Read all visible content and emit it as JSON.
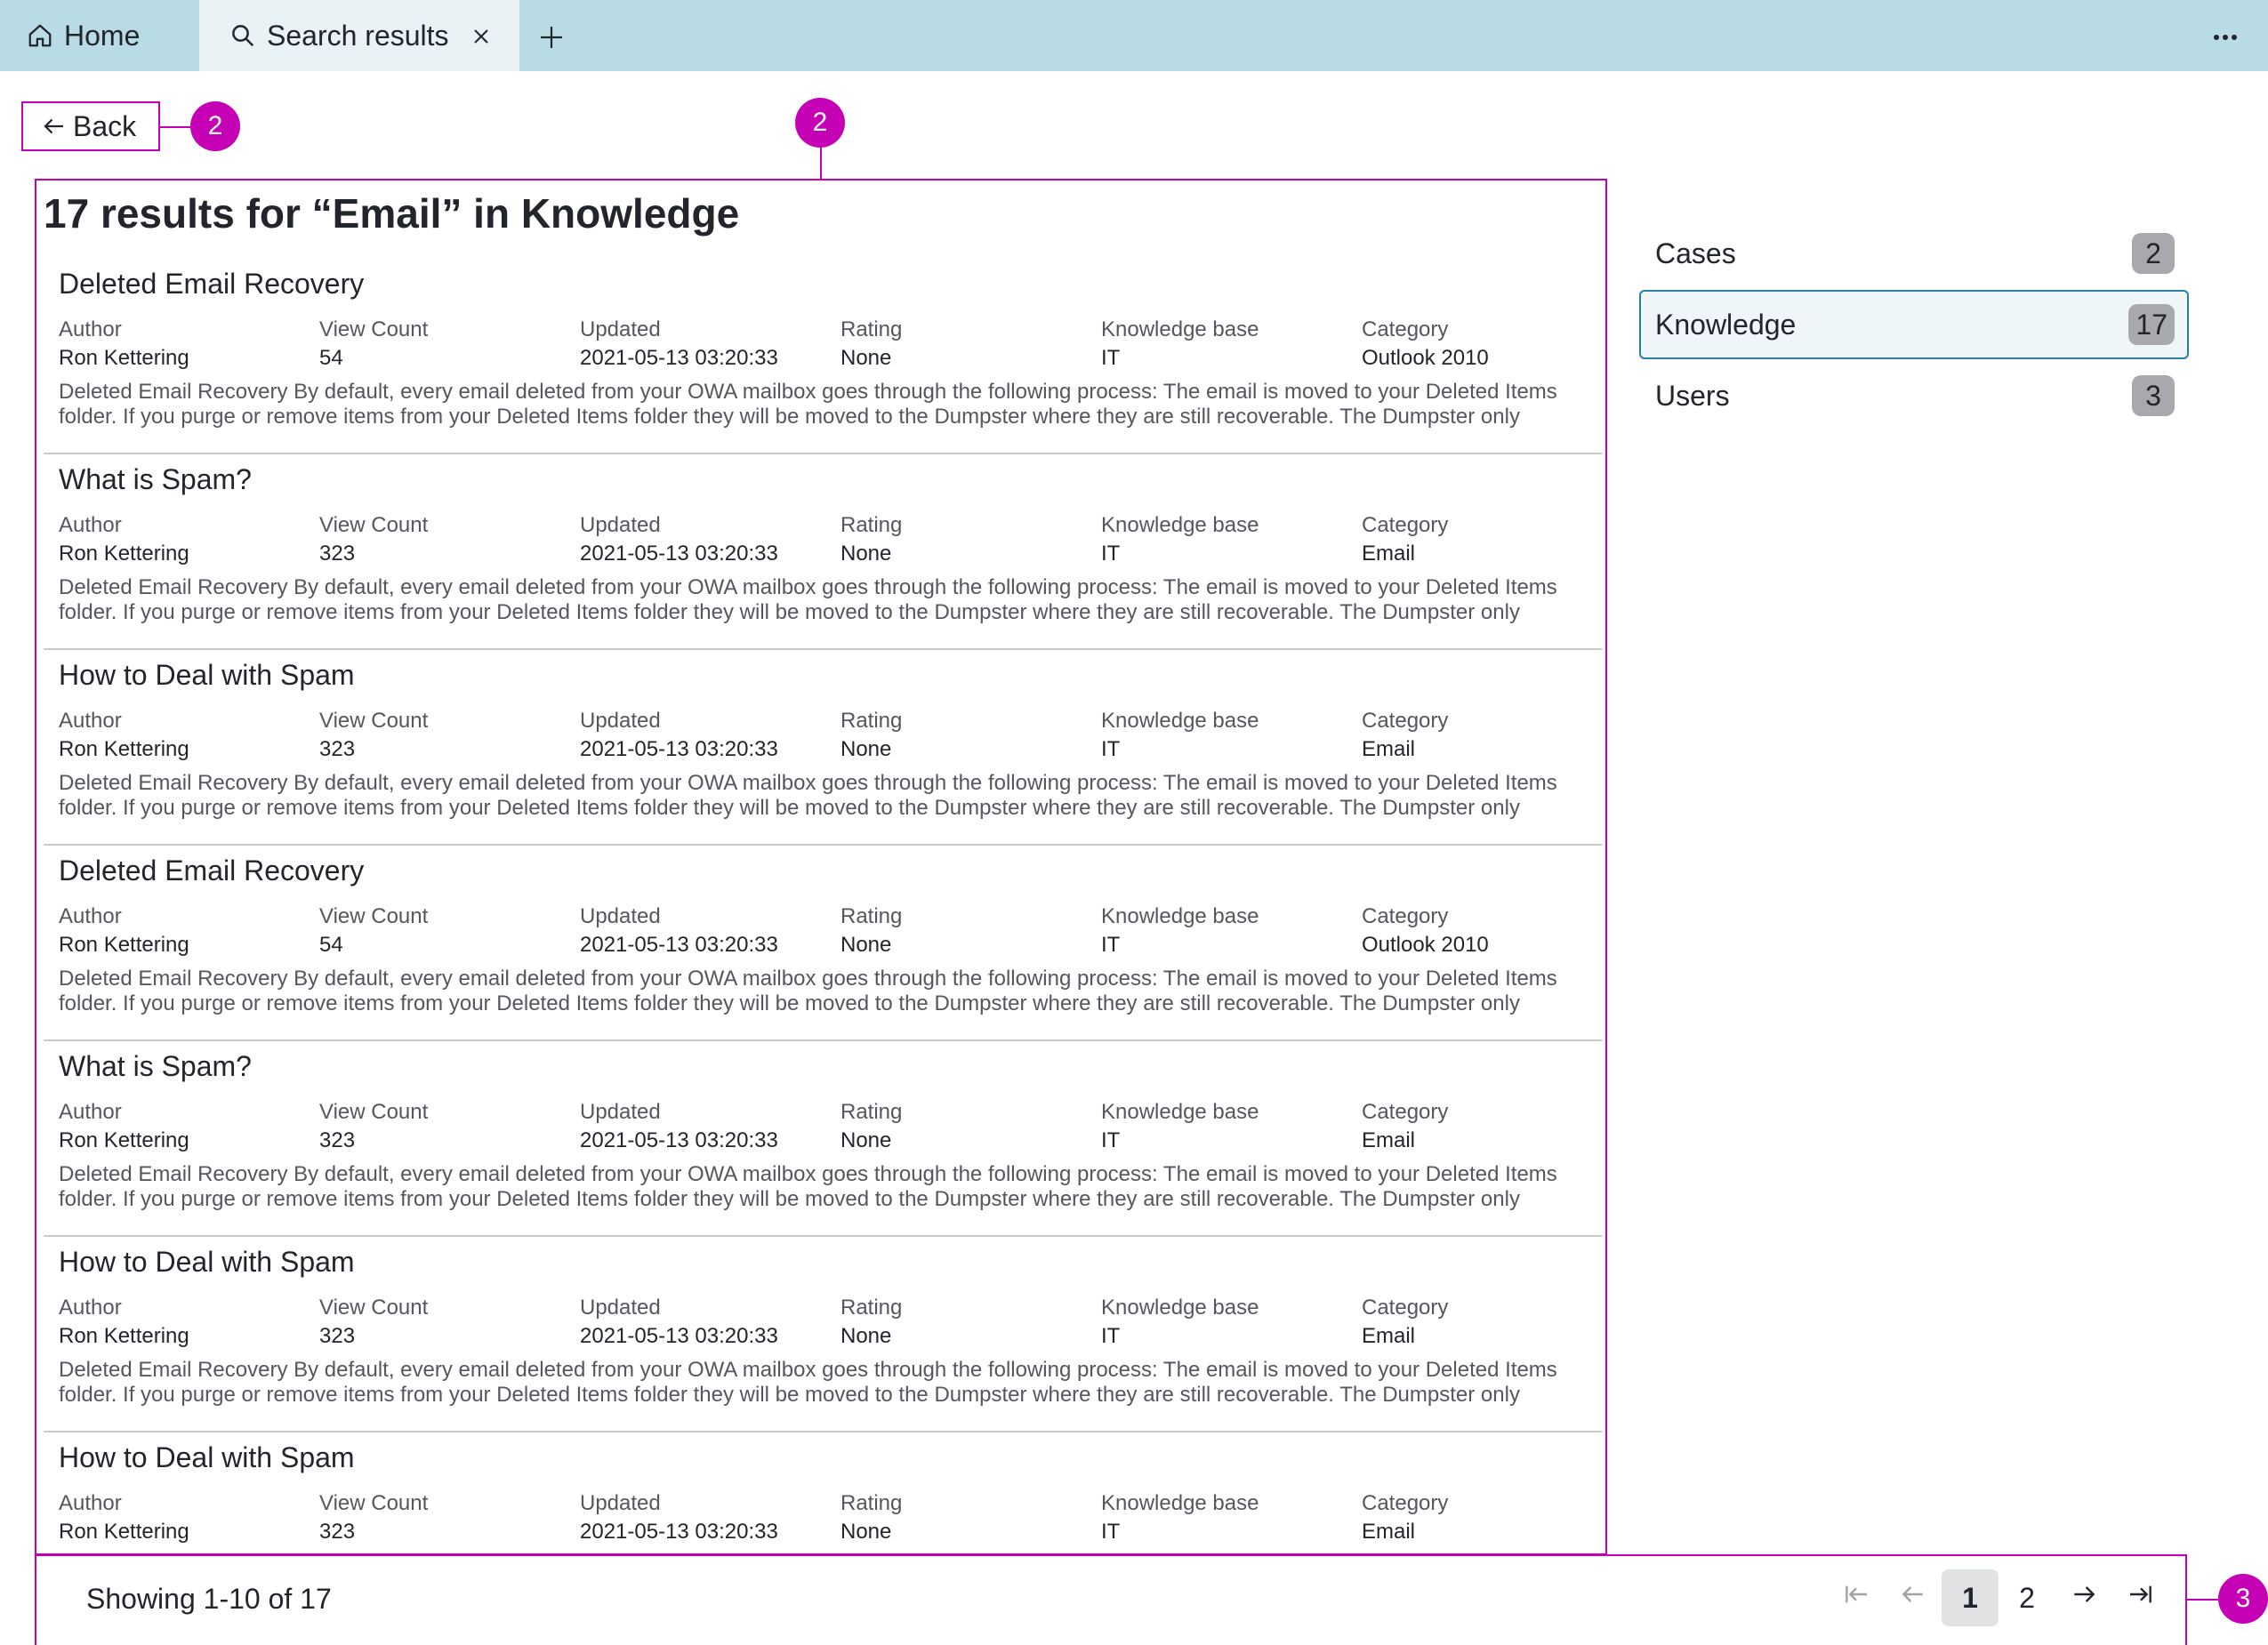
{
  "tabs": {
    "home": {
      "label": "Home",
      "icon": "home-icon"
    },
    "search": {
      "label": "Search results",
      "icon": "search-icon"
    }
  },
  "back": {
    "label": "Back"
  },
  "markers": {
    "back": "2",
    "results": "2",
    "pagination": "3"
  },
  "results": {
    "title": "17 results for “Email” in Knowledge",
    "labels": {
      "author": "Author",
      "view_count": "View Count",
      "updated": "Updated",
      "rating": "Rating",
      "knowledge_base": "Knowledge base",
      "category": "Category"
    },
    "items": [
      {
        "title": "Deleted Email Recovery",
        "author": "Ron Kettering",
        "view_count": "54",
        "updated": "2021-05-13 03:20:33",
        "rating": "None",
        "knowledge_base": "IT",
        "category": "Outlook 2010",
        "snippet": "Deleted Email Recovery By default, every email deleted from your OWA mailbox goes through the following process: The email is moved to your Deleted Items folder. If you purge or remove items from your Deleted Items folder they will be moved to the Dumpster where they are still recoverable. The Dumpster only hold..."
      },
      {
        "title": "What is Spam?",
        "author": "Ron Kettering",
        "view_count": "323",
        "updated": "2021-05-13 03:20:33",
        "rating": "None",
        "knowledge_base": "IT",
        "category": "Email",
        "snippet": "Deleted Email Recovery By default, every email deleted from your OWA mailbox goes through the following process: The email is moved to your Deleted Items folder. If you purge or remove items from your Deleted Items folder they will be moved to the Dumpster where they are still recoverable. The Dumpster only hold..."
      },
      {
        "title": "How to Deal with Spam",
        "author": "Ron Kettering",
        "view_count": "323",
        "updated": "2021-05-13 03:20:33",
        "rating": "None",
        "knowledge_base": "IT",
        "category": "Email",
        "snippet": "Deleted Email Recovery By default, every email deleted from your OWA mailbox goes through the following process: The email is moved to your Deleted Items folder. If you purge or remove items from your Deleted Items folder they will be moved to the Dumpster where they are still recoverable. The Dumpster only hold..."
      },
      {
        "title": "Deleted Email Recovery",
        "author": "Ron Kettering",
        "view_count": "54",
        "updated": "2021-05-13 03:20:33",
        "rating": "None",
        "knowledge_base": "IT",
        "category": "Outlook 2010",
        "snippet": "Deleted Email Recovery By default, every email deleted from your OWA mailbox goes through the following process: The email is moved to your Deleted Items folder. If you purge or remove items from your Deleted Items folder they will be moved to the Dumpster where they are still recoverable. The Dumpster only hold..."
      },
      {
        "title": "What is Spam?",
        "author": "Ron Kettering",
        "view_count": "323",
        "updated": "2021-05-13 03:20:33",
        "rating": "None",
        "knowledge_base": "IT",
        "category": "Email",
        "snippet": "Deleted Email Recovery By default, every email deleted from your OWA mailbox goes through the following process: The email is moved to your Deleted Items folder. If you purge or remove items from your Deleted Items folder they will be moved to the Dumpster where they are still recoverable. The Dumpster only hold..."
      },
      {
        "title": "How to Deal with Spam",
        "author": "Ron Kettering",
        "view_count": "323",
        "updated": "2021-05-13 03:20:33",
        "rating": "None",
        "knowledge_base": "IT",
        "category": "Email",
        "snippet": "Deleted Email Recovery By default, every email deleted from your OWA mailbox goes through the following process: The email is moved to your Deleted Items folder. If you purge or remove items from your Deleted Items folder they will be moved to the Dumpster where they are still recoverable. The Dumpster only hold..."
      },
      {
        "title": "How to Deal with Spam",
        "author": "Ron Kettering",
        "view_count": "323",
        "updated": "2021-05-13 03:20:33",
        "rating": "None",
        "knowledge_base": "IT",
        "category": "Email",
        "snippet": ""
      }
    ]
  },
  "facets": [
    {
      "label": "Cases",
      "count": "2",
      "active": false
    },
    {
      "label": "Knowledge",
      "count": "17",
      "active": true
    },
    {
      "label": "Users",
      "count": "3",
      "active": false
    }
  ],
  "pagination": {
    "showing": "Showing 1-10 of 17",
    "pages": [
      "1",
      "2"
    ],
    "current": "1"
  },
  "colors": {
    "tabbar": "#b9dbe5",
    "annotation": "#c600b4",
    "active_facet_border": "#2a7fa8"
  }
}
